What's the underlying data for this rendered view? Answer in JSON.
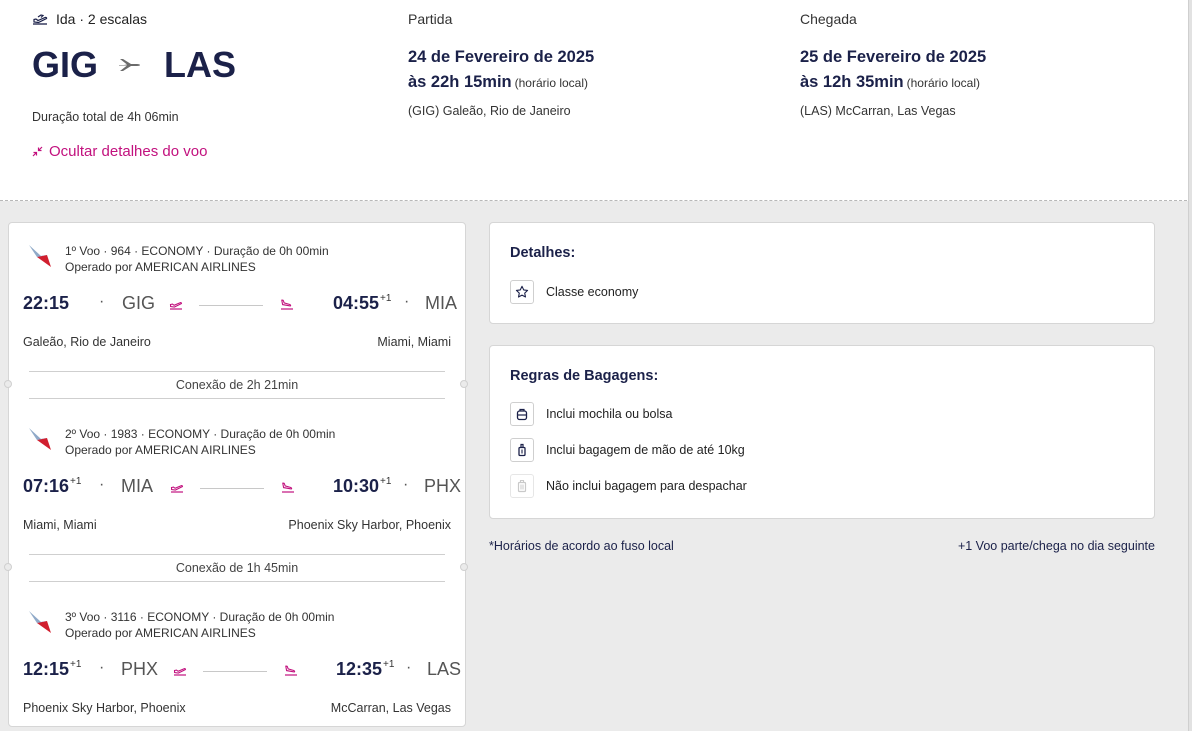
{
  "summary": {
    "trip_type": "Ida · 2 escalas",
    "origin": "GIG",
    "destination": "LAS",
    "duration": "Duração total de 4h 06min",
    "hide_details": "Ocultar detalhes do voo",
    "departure": {
      "label": "Partida",
      "date": "24 de Fevereiro de 2025",
      "time": "às 22h 15min",
      "time_note": "(horário local)",
      "airport": "(GIG) Galeão, Rio de Janeiro"
    },
    "arrival": {
      "label": "Chegada",
      "date": "25 de Fevereiro de 2025",
      "time": "às 12h 35min",
      "time_note": "(horário local)",
      "airport": "(LAS) McCarran, Las Vegas"
    }
  },
  "segments": [
    {
      "info": "1º Voo · 964 · ECONOMY · Duração de 0h 00min",
      "operator": "Operado por AMERICAN AIRLINES",
      "dep_time": "22:15",
      "dep_plus": "",
      "dep_code": "GIG",
      "arr_time": "04:55",
      "arr_plus": "+1",
      "arr_code": "MIA",
      "dep_city": "Galeão, Rio de Janeiro",
      "arr_city": "Miami, Miami"
    },
    {
      "info": "2º Voo · 1983 · ECONOMY · Duração de 0h 00min",
      "operator": "Operado por AMERICAN AIRLINES",
      "dep_time": "07:16",
      "dep_plus": "+1",
      "dep_code": "MIA",
      "arr_time": "10:30",
      "arr_plus": "+1",
      "arr_code": "PHX",
      "dep_city": "Miami, Miami",
      "arr_city": "Phoenix Sky Harbor, Phoenix"
    },
    {
      "info": "3º Voo · 3116 · ECONOMY · Duração de 0h 00min",
      "operator": "Operado por AMERICAN AIRLINES",
      "dep_time": "12:15",
      "dep_plus": "+1",
      "dep_code": "PHX",
      "arr_time": "12:35",
      "arr_plus": "+1",
      "arr_code": "LAS",
      "dep_city": "Phoenix Sky Harbor, Phoenix",
      "arr_city": "McCarran, Las Vegas"
    }
  ],
  "connections": [
    "Conexão de 2h 21min",
    "Conexão de 1h 45min"
  ],
  "details": {
    "title": "Detalhes:",
    "class": "Classe economy"
  },
  "baggage": {
    "title": "Regras de Bagagens:",
    "items": [
      "Inclui mochila ou bolsa",
      "Inclui bagagem de mão de até 10kg",
      "Não inclui bagagem para despachar"
    ]
  },
  "footer": {
    "left": "*Horários de acordo ao fuso local",
    "right": "+1 Voo parte/chega no dia seguinte"
  },
  "colors": {
    "navy": "#1b2149",
    "accent": "#c2117e",
    "background": "#ebebeb"
  }
}
